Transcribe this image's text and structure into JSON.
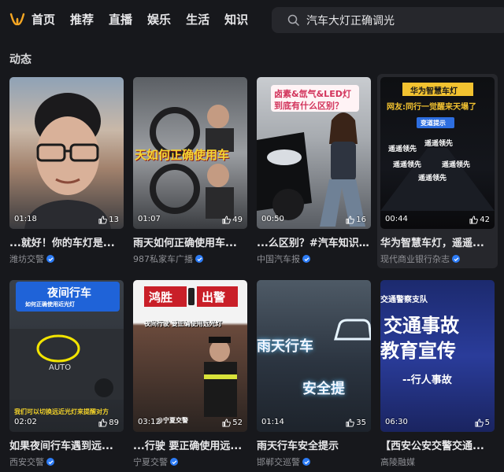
{
  "nav": {
    "items": [
      "首页",
      "推荐",
      "直播",
      "娱乐",
      "生活",
      "知识"
    ]
  },
  "search": {
    "value": "汽车大灯正确调光"
  },
  "section": {
    "title": "动态"
  },
  "cards": [
    {
      "duration": "01:18",
      "likes": "13",
      "title": "...就好！你的车灯是...",
      "author": "潍坊交警",
      "overlay": []
    },
    {
      "duration": "01:07",
      "likes": "49",
      "title": "雨天如何正确使用车...",
      "author": "987私家车广播",
      "overlay": [
        "天如何正确使用车"
      ]
    },
    {
      "duration": "00:50",
      "likes": "16",
      "title": "...么区别？#汽车知识 ...",
      "author": "中国汽车报",
      "overlay": [
        "卤素&氙气&LED灯",
        "到底有什么区别？"
      ]
    },
    {
      "duration": "00:44",
      "likes": "42",
      "title": "华为智慧车灯，遥遥...",
      "author": "现代商业银行杂志",
      "overlay": [
        "华为智慧车灯",
        "网友:同行一觉醒来天塌了",
        "变道提示",
        "遥遥领先",
        "遥遥领先",
        "遥遥领先",
        "遥遥领先",
        "遥遥领先"
      ]
    },
    {
      "duration": "02:02",
      "likes": "89",
      "title": "如果夜间行车遇到远...",
      "author": "西安交警",
      "overlay": [
        "夜间行车",
        "如何正确使用近光灯",
        "我们可以切换远近光灯来提醒对方"
      ]
    },
    {
      "duration": "03:12",
      "likes": "52",
      "title": "...行驶 要正确使用远...",
      "author": "宁夏交警",
      "overlay": [
        "鸿胜",
        "出警",
        "夜间行驶 要正确使用远光灯",
        "@宁夏交警"
      ]
    },
    {
      "duration": "01:14",
      "likes": "35",
      "title": "雨天行车安全提示",
      "author": "邯郸交巡警",
      "overlay": [
        "雨天行车",
        "安全提"
      ]
    },
    {
      "duration": "06:30",
      "likes": "5",
      "title": "【西安公安交警交通...",
      "author": "高陵融媒",
      "overlay": [
        "交通警察支队",
        "交通事故",
        "教育宣传",
        "--行人事故"
      ]
    }
  ]
}
